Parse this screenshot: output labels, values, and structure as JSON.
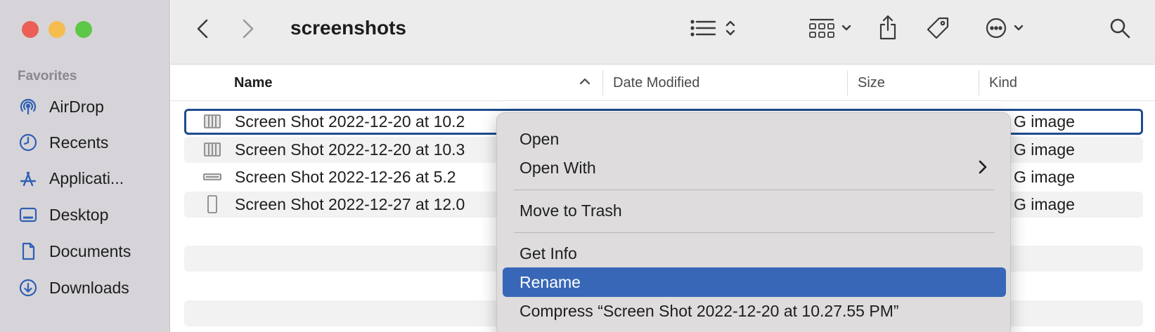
{
  "window": {
    "title": "screenshots"
  },
  "sidebar": {
    "heading": "Favorites",
    "items": [
      {
        "label": "AirDrop",
        "icon": "airdrop-icon"
      },
      {
        "label": "Recents",
        "icon": "clock-icon"
      },
      {
        "label": "Applicati...",
        "icon": "applications-icon"
      },
      {
        "label": "Desktop",
        "icon": "desktop-icon"
      },
      {
        "label": "Documents",
        "icon": "document-icon"
      },
      {
        "label": "Downloads",
        "icon": "download-icon"
      }
    ]
  },
  "columns": {
    "name": "Name",
    "date": "Date Modified",
    "size": "Size",
    "kind": "Kind"
  },
  "files": [
    {
      "name": "Screen Shot 2022-12-20 at 10.2",
      "kind": "G image"
    },
    {
      "name": "Screen Shot 2022-12-20 at 10.3",
      "kind": "G image"
    },
    {
      "name": "Screen Shot 2022-12-26 at 5.2",
      "kind": "G image"
    },
    {
      "name": "Screen Shot 2022-12-27 at 12.0",
      "kind": "G image"
    }
  ],
  "context_menu": {
    "open": "Open",
    "open_with": "Open With",
    "move_to_trash": "Move to Trash",
    "get_info": "Get Info",
    "rename": "Rename",
    "compress": "Compress “Screen Shot 2022-12-20 at 10.27.55 PM”"
  },
  "colors": {
    "selection": "#3867b7",
    "sidebar_icon": "#2f5fb4",
    "selected_border": "#1f4b8c"
  }
}
